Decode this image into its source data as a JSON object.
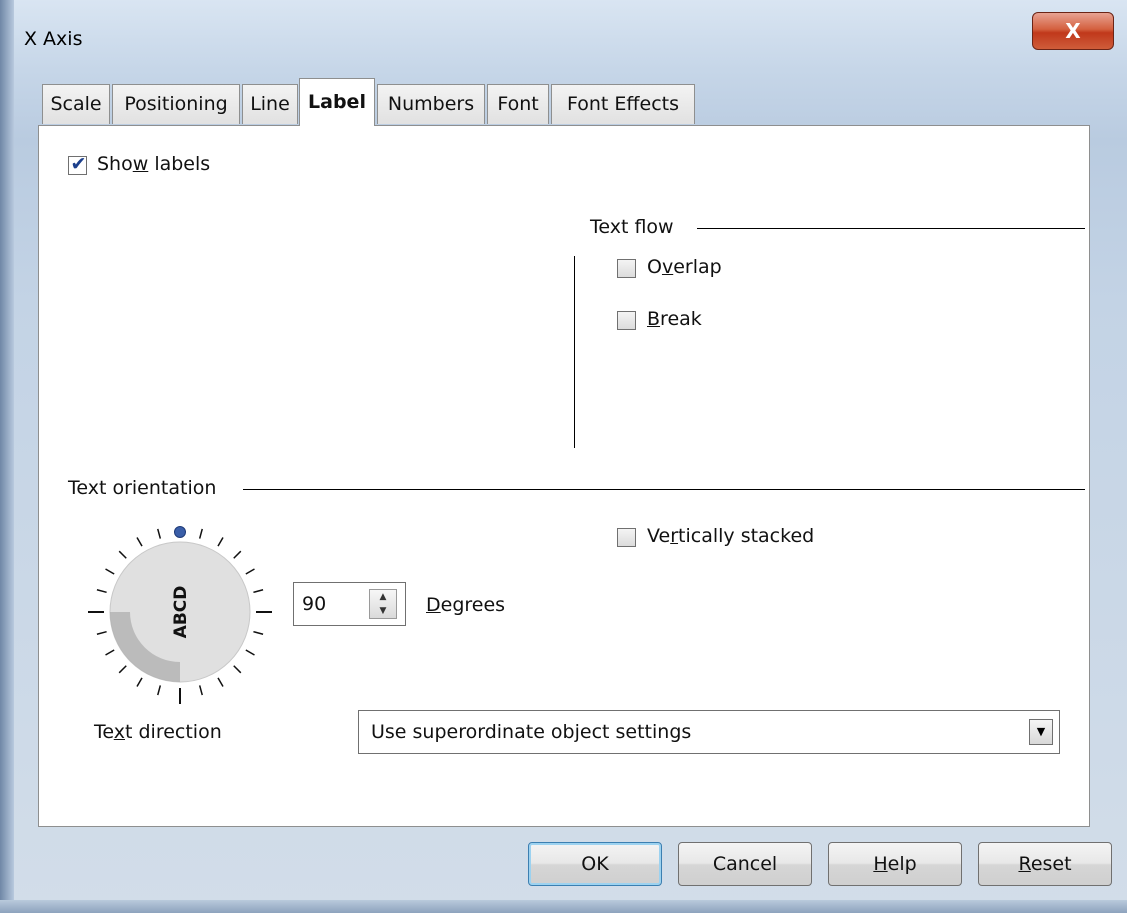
{
  "window": {
    "title": "X Axis",
    "close_label": "X"
  },
  "tabs": [
    {
      "label": "Scale",
      "active": false
    },
    {
      "label": "Positioning",
      "active": false
    },
    {
      "label": "Line",
      "active": false
    },
    {
      "label": "Label",
      "active": true
    },
    {
      "label": "Numbers",
      "active": false
    },
    {
      "label": "Font",
      "active": false
    },
    {
      "label": "Font Effects",
      "active": false
    }
  ],
  "show_labels": {
    "before": "Sho",
    "mnemonic": "w",
    "after": " labels",
    "checked": true
  },
  "text_flow": {
    "title": "Text flow",
    "overlap": {
      "before": "O",
      "mnemonic": "v",
      "after": "erlap",
      "checked": false
    },
    "break": {
      "before": "",
      "mnemonic": "B",
      "after": "reak",
      "checked": false
    }
  },
  "text_orientation": {
    "title": "Text orientation",
    "dial_text": "ABCD",
    "vertically_stacked": {
      "before": "Ve",
      "mnemonic": "r",
      "after": "tically stacked",
      "checked": false
    },
    "degrees_value": "90",
    "degrees_label": {
      "before": "",
      "mnemonic": "D",
      "after": "egrees"
    }
  },
  "text_direction": {
    "label": {
      "before": "Te",
      "mnemonic": "x",
      "after": "t direction"
    },
    "selected": "Use superordinate object settings"
  },
  "buttons": {
    "ok": {
      "before": "",
      "mnemonic": "",
      "after": "OK"
    },
    "cancel": {
      "before": "",
      "mnemonic": "",
      "after": "Cancel"
    },
    "help": {
      "before": "",
      "mnemonic": "H",
      "after": "elp"
    },
    "reset": {
      "before": "",
      "mnemonic": "R",
      "after": "eset"
    }
  },
  "colors": {
    "checkmark": "#1c3f8c",
    "dial_marker": "#3a5ea8",
    "default_button_glow": "#9cd2f0"
  }
}
